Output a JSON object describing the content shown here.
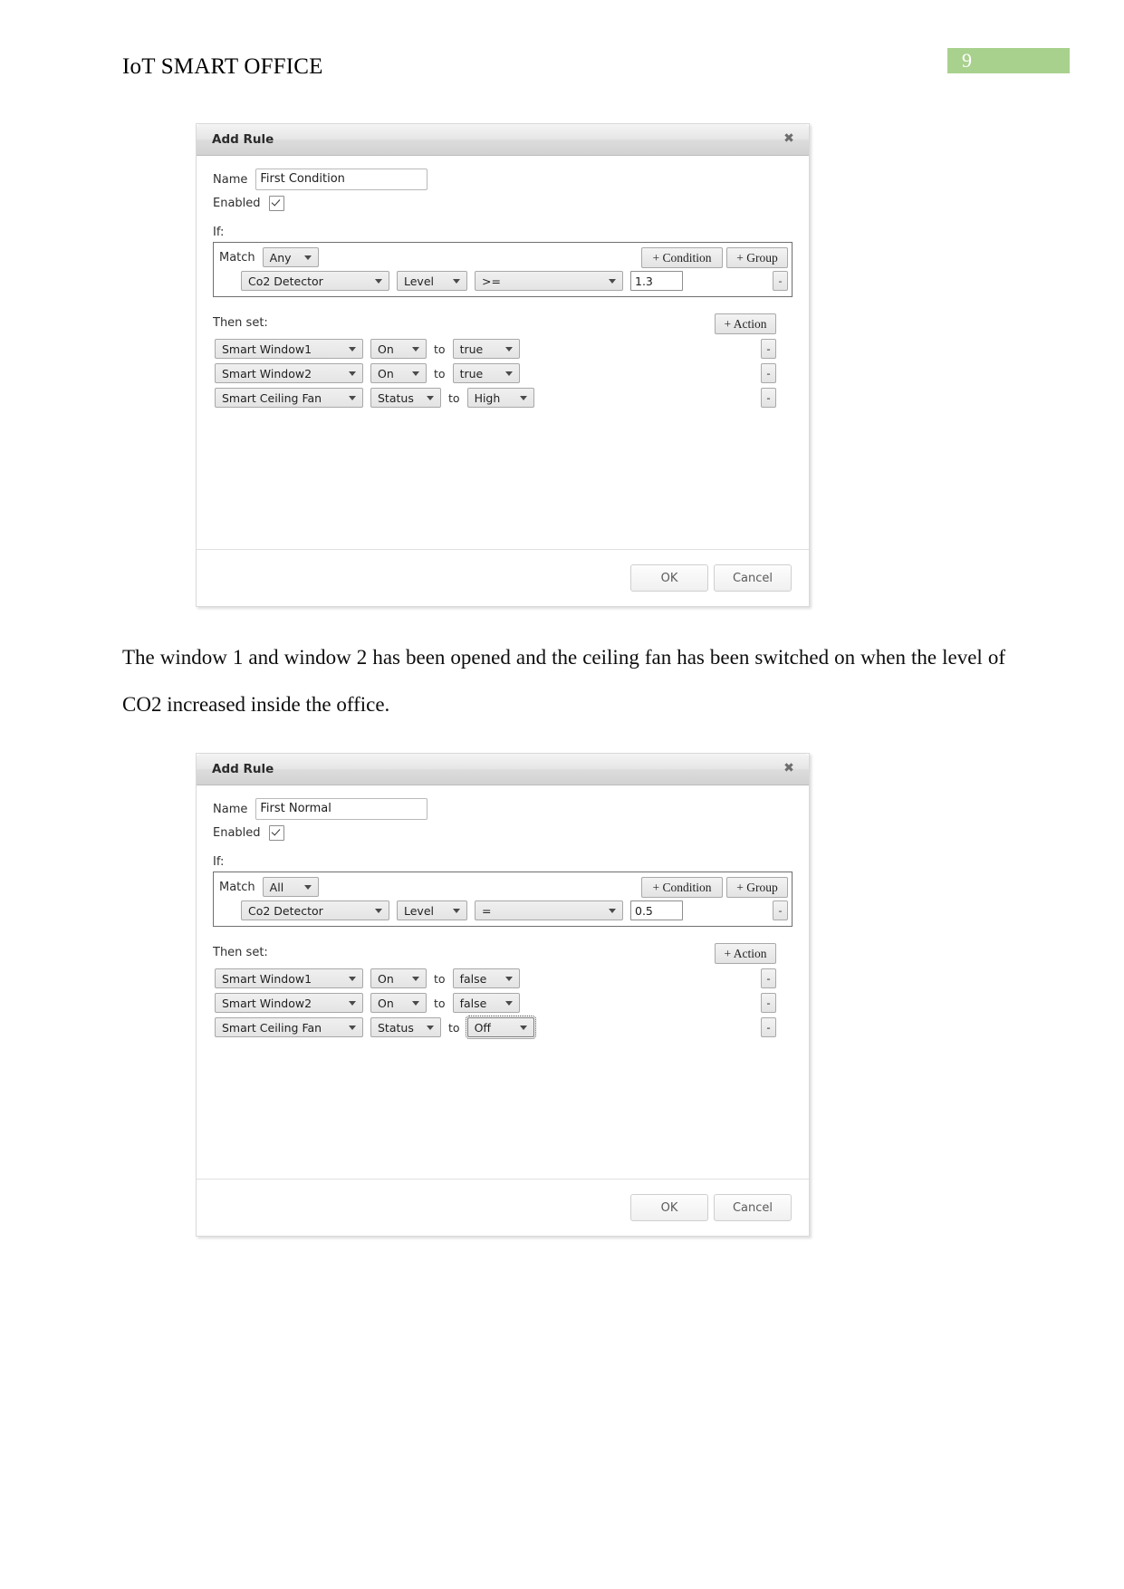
{
  "header": {
    "doc_title": "IoT SMART OFFICE",
    "page_number": "9"
  },
  "paragraph": "The window 1 and window 2 has been opened and the ceiling fan has been switched on when the level of CO2 increased inside the office.",
  "common": {
    "dialog_title": "Add Rule",
    "close_glyph": "✖",
    "name_label": "Name",
    "enabled_label": "Enabled",
    "if_label": "If:",
    "match_label": "Match",
    "then_label": "Then set:",
    "add_condition_label": "+ Condition",
    "add_group_label": "+ Group",
    "add_action_label": "+ Action",
    "remove_label": "-",
    "to_label": "to",
    "ok_label": "OK",
    "cancel_label": "Cancel"
  },
  "dialog1": {
    "title": "Add Rule",
    "name_value": "First Condition",
    "enabled_checked": true,
    "match_value": "Any",
    "conditions": [
      {
        "device": "Co2 Detector",
        "property": "Level",
        "operator": ">=",
        "value": "1.3"
      }
    ],
    "actions": [
      {
        "device": "Smart Window1",
        "property": "On",
        "value": "true",
        "focused": false
      },
      {
        "device": "Smart Window2",
        "property": "On",
        "value": "true",
        "focused": false
      },
      {
        "device": "Smart Ceiling Fan",
        "property": "Status",
        "value": "High",
        "focused": false
      }
    ]
  },
  "dialog2": {
    "title": "Add Rule",
    "name_value": "First Normal",
    "enabled_checked": true,
    "match_value": "All",
    "conditions": [
      {
        "device": "Co2 Detector",
        "property": "Level",
        "operator": "=",
        "value": "0.5"
      }
    ],
    "actions": [
      {
        "device": "Smart Window1",
        "property": "On",
        "value": "false",
        "focused": false
      },
      {
        "device": "Smart Window2",
        "property": "On",
        "value": "false",
        "focused": false
      },
      {
        "device": "Smart Ceiling Fan",
        "property": "Status",
        "value": "Off",
        "focused": true
      }
    ]
  },
  "colors": {
    "page_badge": "#a9d18e",
    "dialog_border": "#d9d9d9",
    "if_box_border": "#6f6f6f"
  }
}
